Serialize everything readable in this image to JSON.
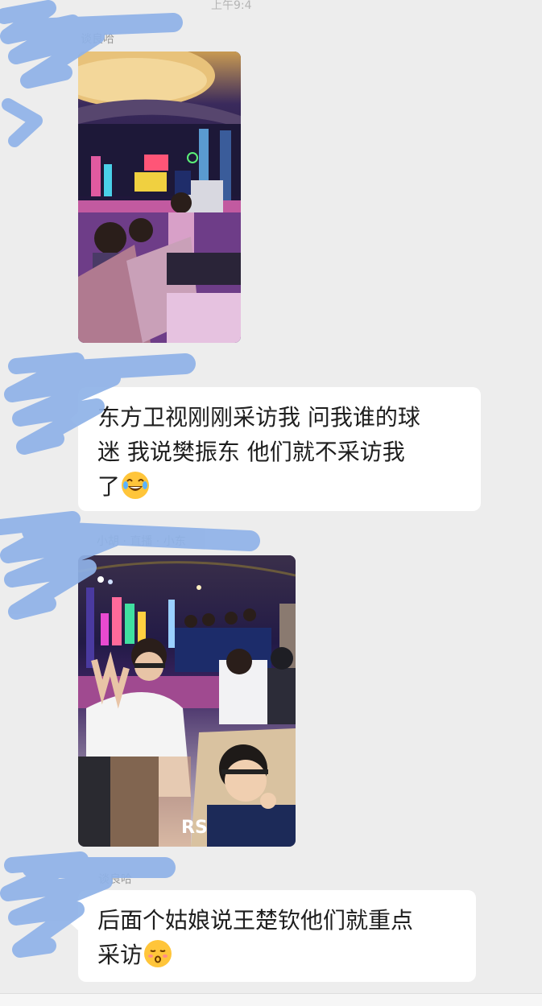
{
  "top_label": "上午9:4",
  "sender_1": "谈良哈",
  "sender_2": "小胡 · 直播 · 小东",
  "sender_3": "谈良哈",
  "messages": [
    {
      "type": "text",
      "text": "东方卫视刚刚采访我 问我谁的球迷 我说樊振东 他们就不采访我了",
      "line1": "东方卫视刚刚采访我 问我谁的球",
      "line2": "迷 我说樊振东 他们就不采访我",
      "line3": "了",
      "emoji": "tears-of-joy-emoji"
    },
    {
      "type": "text",
      "text": "后面个姑娘说王楚钦他们就重点采访",
      "line1": "后面个姑娘说王楚钦他们就重点",
      "line2": "采访",
      "emoji": "kissing-face-emoji"
    }
  ],
  "photo_2_jacket_text": "RS"
}
